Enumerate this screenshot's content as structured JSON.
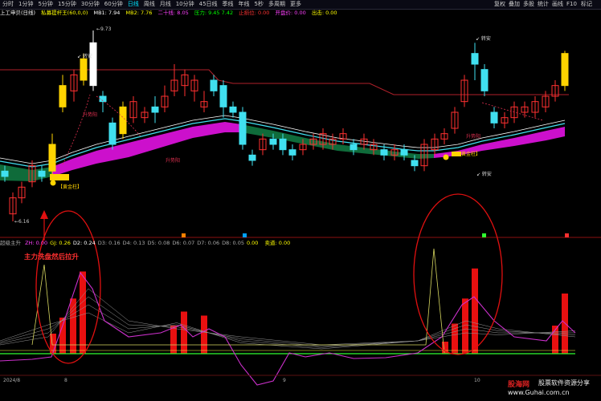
{
  "toolbar": {
    "timeframes": [
      "分时",
      "1分钟",
      "5分钟",
      "15分钟",
      "30分钟",
      "60分钟",
      "日线",
      "周线",
      "月线",
      "10分钟",
      "45日线",
      "季线",
      "年线",
      "5秒",
      "多周期",
      "更多"
    ],
    "active": "日线",
    "right_buttons": [
      "复权",
      "叠加",
      "多股",
      "统计",
      "画线",
      "F10",
      "标记"
    ]
  },
  "info": {
    "stock": "上工申贝(日线)",
    "indicator": "私募提杆王(60,0,0)",
    "mb1": "MB1: 7.94",
    "mb2": "MB2: 7.76",
    "ershi": "二十线: 8.05",
    "yali": "压力: 9.45  7.42",
    "zhisun": "止损位: 0.00",
    "kaijia": "开盘价: 0.00",
    "jiechu": "出击: 0.00"
  },
  "main_chart": {
    "price_high": "9.73",
    "price_low": "6.16",
    "labels": {
      "golden_pillar": "【黄金柱】",
      "golden_pillar2": "黄金柱】",
      "buy1": "↙ 转安",
      "buy2": "↙ 转安",
      "buy3": "↙ 转安",
      "rise1": "升势阳",
      "rise2": "升势阳",
      "rise3": "升势阳"
    },
    "markers": [
      "B",
      "B",
      "B",
      "B"
    ]
  },
  "indicator_bar": {
    "name": "超级主升",
    "values": [
      "ZH: 0.00",
      "GJ: 0.26",
      "D2: 0.24",
      "D3: 0.16",
      "D4: 0.13",
      "D5: 0.08",
      "D6: 0.07",
      "D7: 0.06",
      "D8: 0.05",
      "0.00"
    ],
    "sell": "卖道: 0.00"
  },
  "annotation": "主力洗盘然后拉升",
  "dates": [
    "2024/8",
    "8",
    "9",
    "10"
  ],
  "watermark": {
    "site": "股海网",
    "slogan": "股票软件资源分享",
    "url": "www.Guhai.com.cn"
  },
  "colors": {
    "up": "#ff3030",
    "down": "#40e0f0",
    "ma_cloud_up": "#cc10cc",
    "ma_cloud_down": "#0f6b3a"
  }
}
